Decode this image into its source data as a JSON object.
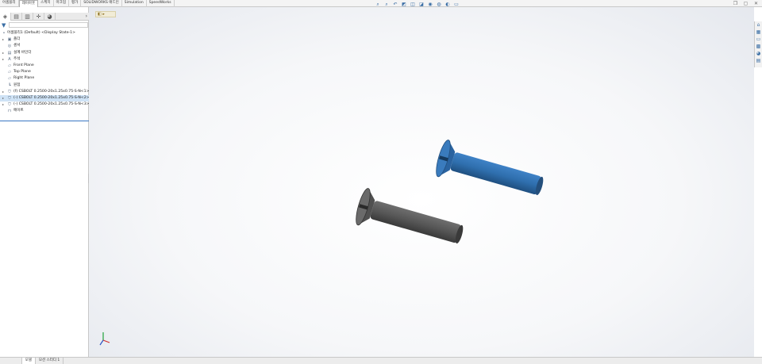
{
  "ribbon": {
    "tabs": [
      {
        "label": "어셈블리",
        "active": false
      },
      {
        "label": "레이아웃",
        "active": true
      },
      {
        "label": "스케치",
        "active": false
      },
      {
        "label": "마크업",
        "active": false
      },
      {
        "label": "평가",
        "active": false
      },
      {
        "label": "SOLIDWORKS 애드인",
        "active": false
      },
      {
        "label": "Simulation",
        "active": false
      },
      {
        "label": "SpeedWorks",
        "active": false
      }
    ]
  },
  "heads_up_toolbar": [
    "zoom-to-fit-icon",
    "zoom-area-icon",
    "previous-view-icon",
    "section-view-icon",
    "view-orientation-icon",
    "display-style-icon",
    "hide-show-icon",
    "edit-appearance-icon",
    "apply-scene-icon",
    "view-settings-icon"
  ],
  "window_controls": [
    "restore-icon",
    "tile-icon",
    "close-icon"
  ],
  "manager_tabs": [
    "featuremanager-icon",
    "propertymanager-icon",
    "configurationmanager-icon",
    "dimxpert-icon",
    "displaymanager-icon"
  ],
  "tree": {
    "root": "어셈블리1 (Default) <Display State-1>",
    "items": [
      {
        "label": "폴더",
        "icon": "folder-icon",
        "expandable": true
      },
      {
        "label": "센서",
        "icon": "sensor-icon",
        "expandable": false
      },
      {
        "label": "설계 바인더",
        "icon": "binder-icon",
        "expandable": true
      },
      {
        "label": "주석",
        "icon": "annotation-icon",
        "expandable": true
      },
      {
        "label": "Front Plane",
        "icon": "plane-icon",
        "expandable": false
      },
      {
        "label": "Top Plane",
        "icon": "plane-icon",
        "expandable": false
      },
      {
        "label": "Right Plane",
        "icon": "plane-icon",
        "expandable": false
      },
      {
        "label": "원점",
        "icon": "origin-icon",
        "expandable": false
      },
      {
        "label": "(f) CSBOLT 0.2500-20x1.25x0.75-S-N<1> (Cl",
        "icon": "part-icon",
        "expandable": true,
        "selected": false
      },
      {
        "label": "(-) CSBOLT 0.2500-20x1.25x0.75-S-N<2> (Cl",
        "icon": "part-icon",
        "expandable": true,
        "selected": true
      },
      {
        "label": "(-) CSBOLT 0.2500-20x1.25x0.75-S-N<3> (Cl",
        "icon": "part-icon",
        "expandable": true,
        "selected": false
      },
      {
        "label": "메이트",
        "icon": "mates-icon",
        "expandable": false
      }
    ]
  },
  "bottom_tabs": [
    {
      "label": "",
      "active": false
    },
    {
      "label": "모델",
      "active": true
    },
    {
      "label": "모션 스터디 1",
      "active": false
    }
  ],
  "colors": {
    "blue_bolt": "#2f6fae",
    "gray_bolt": "#5a5a5a",
    "selection": "#cfe3f6",
    "accent": "#3a78c3"
  },
  "task_pane": [
    "solidworks-resources-icon",
    "design-library-icon",
    "file-explorer-icon",
    "view-palette-icon",
    "appearances-icon",
    "custom-properties-icon"
  ]
}
